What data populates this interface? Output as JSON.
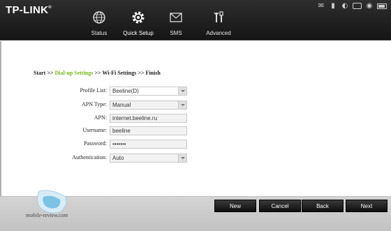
{
  "brand": {
    "logo": "TP-LINK",
    "trademark": "®"
  },
  "status_bar": {
    "icons": [
      "sms-envelope-icon",
      "signal-bars-icon",
      "globe-icon",
      "roaming-box-icon",
      "wifi-icon",
      "battery-icon"
    ]
  },
  "nav": {
    "items": [
      {
        "label": "Status",
        "icon": "globe-icon"
      },
      {
        "label": "Quick Setup",
        "icon": "gear-icon",
        "active": true
      },
      {
        "label": "SMS",
        "icon": "envelope-icon"
      },
      {
        "label": "Advanced",
        "icon": "tools-icon"
      }
    ]
  },
  "breadcrumb": {
    "start": "Start >> ",
    "dialup": "Dial-up Settings",
    "sep1": " >> ",
    "wifi": "Wi-Fi Settings",
    "sep2": " >> ",
    "finish": "Finish"
  },
  "form": {
    "profile_list": {
      "label": "Profile List:",
      "value": "Beeline(D)"
    },
    "apn_type": {
      "label": "APN Type:",
      "value": "Manual"
    },
    "apn": {
      "label": "APN:",
      "value": "internet.beeline.ru"
    },
    "username": {
      "label": "Username:",
      "value": "beeline"
    },
    "password": {
      "label": "Password:",
      "value": "•••••••"
    },
    "authentication": {
      "label": "Authentication:",
      "value": "Auto"
    }
  },
  "buttons": {
    "new": "New",
    "cancel": "Cancel",
    "back": "Back",
    "next": "Next"
  },
  "watermark": {
    "text": "mobile-review.com"
  },
  "colors": {
    "accent_green": "#7ab51d",
    "header_bg": "#1e1e1e",
    "button_bg": "#1a1a1a"
  }
}
